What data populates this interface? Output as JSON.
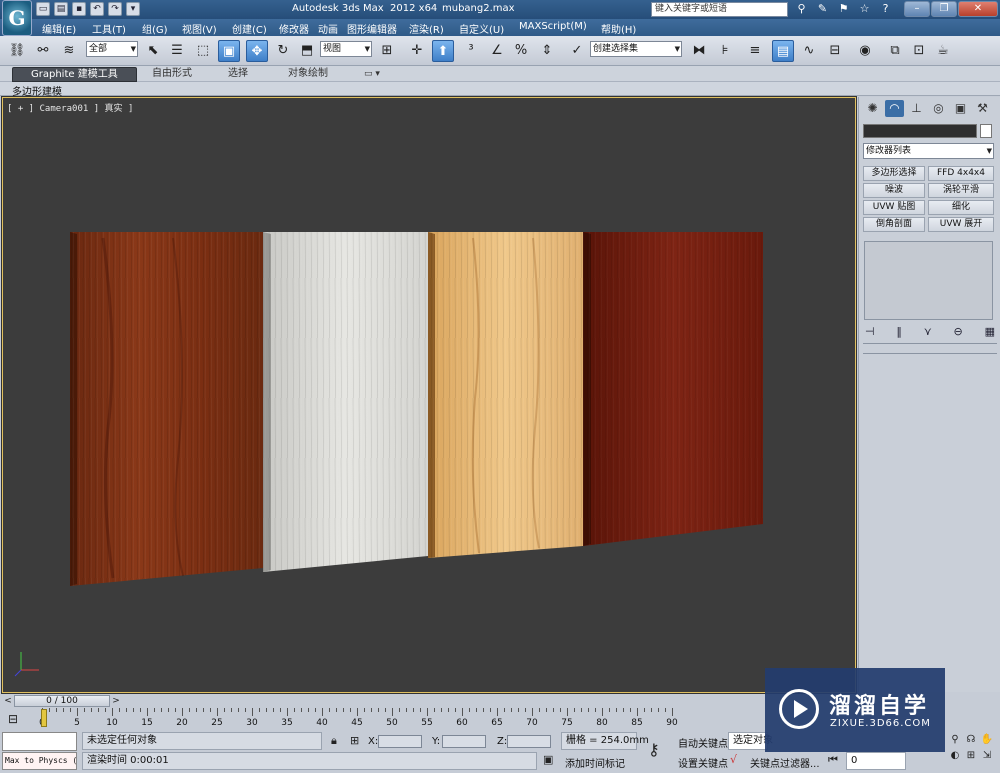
{
  "title": {
    "app": "Autodesk 3ds Max  2012 x64",
    "file": "mubang2.max",
    "search_placeholder": "键入关键字或短语"
  },
  "menu": [
    "编辑(E)",
    "工具(T)",
    "组(G)",
    "视图(V)",
    "创建(C)",
    "修改器",
    "动画",
    "图形编辑器",
    "渲染(R)",
    "自定义(U)",
    "MAXScript(M)",
    "帮助(H)"
  ],
  "toolbar": {
    "selection_filter": "全部",
    "reference_coord": "视图",
    "named_selection": "创建选择集"
  },
  "ribbon": {
    "tabs": [
      "Graphite 建模工具",
      "自由形式",
      "选择",
      "对象绘制"
    ],
    "sub_label": "多边形建模"
  },
  "viewport": {
    "label": "[ + ] Camera001 ] 真实 ]"
  },
  "command_panel": {
    "modifier_list": "修改器列表",
    "buttons": [
      "多边形选择",
      "FFD 4x4x4",
      "噪波",
      "涡轮平滑",
      "UVW 贴图",
      "细化",
      "倒角剖面",
      "UVW 展开"
    ]
  },
  "timeline": {
    "frame_display": "0 / 100",
    "ticks": [
      0,
      5,
      10,
      15,
      20,
      25,
      30,
      35,
      40,
      45,
      50,
      55,
      60,
      65,
      70,
      75,
      80,
      85,
      90
    ],
    "frame": 0,
    "frame_end": 100
  },
  "status": {
    "maxscript_listener": "Max to Physcs (",
    "selection_msg": "未选定任何对象",
    "render_time": "渲染时间  0:00:01",
    "x_label": "X:",
    "y_label": "Y:",
    "z_label": "Z:",
    "grid": "栅格 = 254.0mm",
    "add_time_tag": "添加时间标记",
    "auto_key": "自动关键点",
    "set_key": "设置关键点",
    "selected_obj": "选定对象",
    "key_filters": "关键点过滤器...",
    "frame_field": "0"
  },
  "watermark": {
    "title": "溜溜自学",
    "url": "ZIXUE.3D66.COM"
  },
  "colors": {
    "titlebar": "#2b5683",
    "viewport_bg": "#3c3c3c",
    "active_button": "#3e7fc8",
    "viewport_border": "#e0c060"
  }
}
